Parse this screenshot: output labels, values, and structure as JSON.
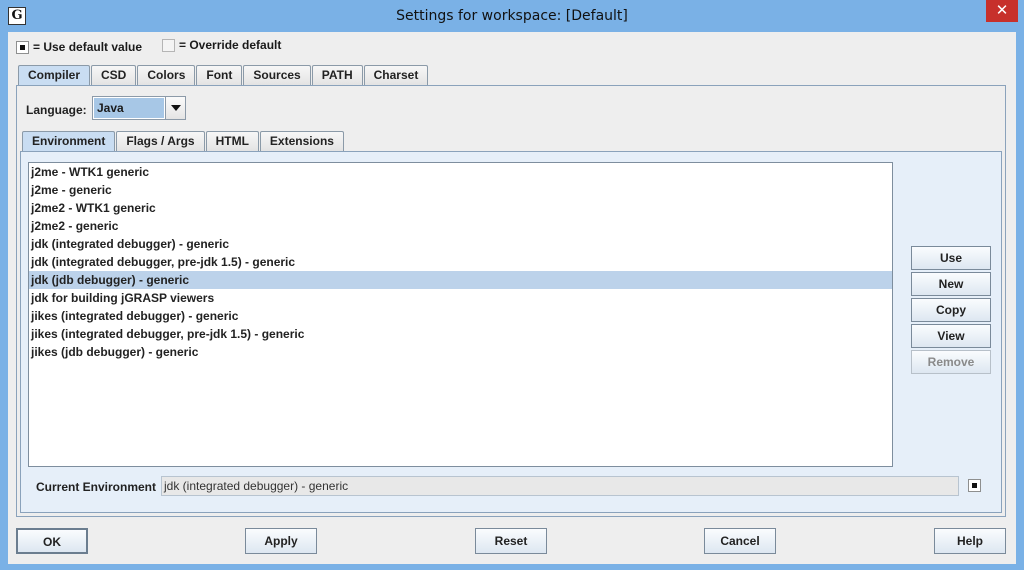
{
  "window": {
    "title": "Settings for workspace: [Default]",
    "icon_letter": "G",
    "close_glyph": "✕"
  },
  "legend": {
    "default_label": "= Use default value",
    "override_label": "= Override default"
  },
  "top_tabs": [
    {
      "label": "Compiler",
      "active": true
    },
    {
      "label": "CSD",
      "active": false
    },
    {
      "label": "Colors",
      "active": false
    },
    {
      "label": "Font",
      "active": false
    },
    {
      "label": "Sources",
      "active": false
    },
    {
      "label": "PATH",
      "active": false
    },
    {
      "label": "Charset",
      "active": false
    }
  ],
  "language": {
    "label": "Language:",
    "value": "Java"
  },
  "sub_tabs": [
    {
      "label": "Environment",
      "active": true
    },
    {
      "label": "Flags / Args",
      "active": false
    },
    {
      "label": "HTML",
      "active": false
    },
    {
      "label": "Extensions",
      "active": false
    }
  ],
  "environments": [
    {
      "label": "j2me - WTK1 generic",
      "selected": false
    },
    {
      "label": "j2me - generic",
      "selected": false
    },
    {
      "label": "j2me2 - WTK1 generic",
      "selected": false
    },
    {
      "label": "j2me2 - generic",
      "selected": false
    },
    {
      "label": "jdk (integrated debugger) - generic",
      "selected": false
    },
    {
      "label": "jdk (integrated debugger, pre-jdk 1.5) - generic",
      "selected": false
    },
    {
      "label": "jdk (jdb debugger) - generic",
      "selected": true
    },
    {
      "label": "jdk for building jGRASP viewers",
      "selected": false
    },
    {
      "label": "jikes (integrated debugger) - generic",
      "selected": false
    },
    {
      "label": "jikes (integrated debugger, pre-jdk 1.5) - generic",
      "selected": false
    },
    {
      "label": "jikes (jdb debugger) - generic",
      "selected": false
    }
  ],
  "env_buttons": {
    "use": "Use",
    "new": "New",
    "copy": "Copy",
    "view": "View",
    "remove": "Remove"
  },
  "current_env": {
    "label": "Current Environment",
    "value": "jdk (integrated debugger) - generic"
  },
  "footer": {
    "ok": "OK",
    "apply": "Apply",
    "reset": "Reset",
    "cancel": "Cancel",
    "help": "Help"
  }
}
